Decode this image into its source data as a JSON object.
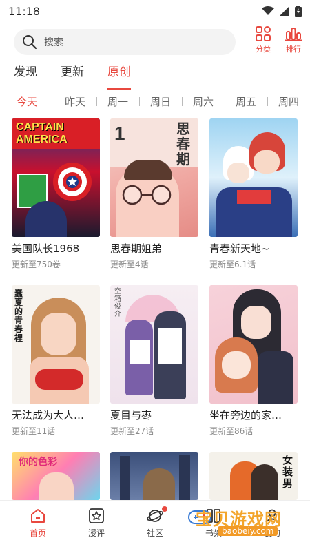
{
  "status_bar": {
    "time": "11:18"
  },
  "search": {
    "placeholder": "搜索"
  },
  "top_actions": [
    {
      "label": "分类",
      "icon": "category-grid-icon"
    },
    {
      "label": "排行",
      "icon": "ranking-bars-icon"
    }
  ],
  "main_tabs": [
    {
      "label": "发现",
      "active": false
    },
    {
      "label": "更新",
      "active": false
    },
    {
      "label": "原创",
      "active": true
    }
  ],
  "day_tabs": [
    "今天",
    "昨天",
    "周一",
    "周日",
    "周六",
    "周五",
    "周四"
  ],
  "comics": [
    {
      "title": "美国队长1968",
      "update": "更新至750卷",
      "cover_text": "CAPTAIN AMERICA"
    },
    {
      "title": "思春期姐弟",
      "update": "更新至4话",
      "cover_text": "思春期"
    },
    {
      "title": "青春新天地~",
      "update": "更新至6.1话"
    },
    {
      "title": "无法成为大人…",
      "update": "更新至11话"
    },
    {
      "title": "夏目与枣",
      "update": "更新至27话"
    },
    {
      "title": "坐在旁边的家…",
      "update": "更新至86话"
    },
    {
      "title": "你的色彩",
      "update": ""
    },
    {
      "title": "",
      "update": ""
    },
    {
      "title": "女装男",
      "update": ""
    }
  ],
  "bottom_nav": [
    {
      "label": "首页",
      "active": true,
      "icon": "home-icon"
    },
    {
      "label": "漫评",
      "active": false,
      "icon": "star-box-icon"
    },
    {
      "label": "社区",
      "active": false,
      "icon": "planet-icon"
    },
    {
      "label": "书架",
      "active": false,
      "icon": "bookshelf-icon"
    },
    {
      "label": "我的",
      "active": false,
      "icon": "profile-icon"
    }
  ],
  "watermark": {
    "text": "宝贝游戏网",
    "url": "baobeiy.com"
  },
  "colors": {
    "accent": "#e8483f",
    "search_bg": "#f3f3f3"
  }
}
